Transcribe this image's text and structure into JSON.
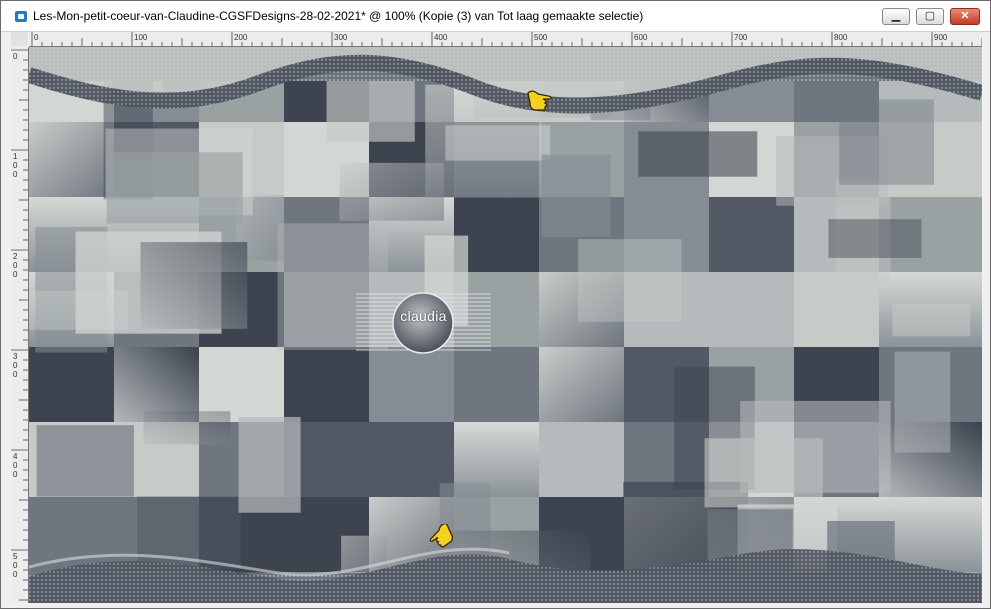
{
  "window": {
    "title": "Les-Mon-petit-coeur-van-Claudine-CGSFDesigns-28-02-2021* @ 100% (Kopie (3) van Tot laag gemaakte selectie)",
    "controls": [
      "minimize-icon",
      "maximize-icon",
      "close-icon"
    ]
  },
  "ruler": {
    "top_labels": [
      "0",
      "100",
      "200",
      "300",
      "400",
      "500",
      "600",
      "700",
      "800",
      "900"
    ],
    "left_labels": [
      "0",
      "100",
      "200",
      "300",
      "400",
      "500"
    ]
  },
  "canvas": {
    "watermark_text": "claudia",
    "pointer_icon": "pointing-hand-icon",
    "colors": {
      "light": "#c6cbc8",
      "mid": "#9aa1a3",
      "dark": "#3d434f",
      "border_light": "#e0e3e0"
    }
  }
}
